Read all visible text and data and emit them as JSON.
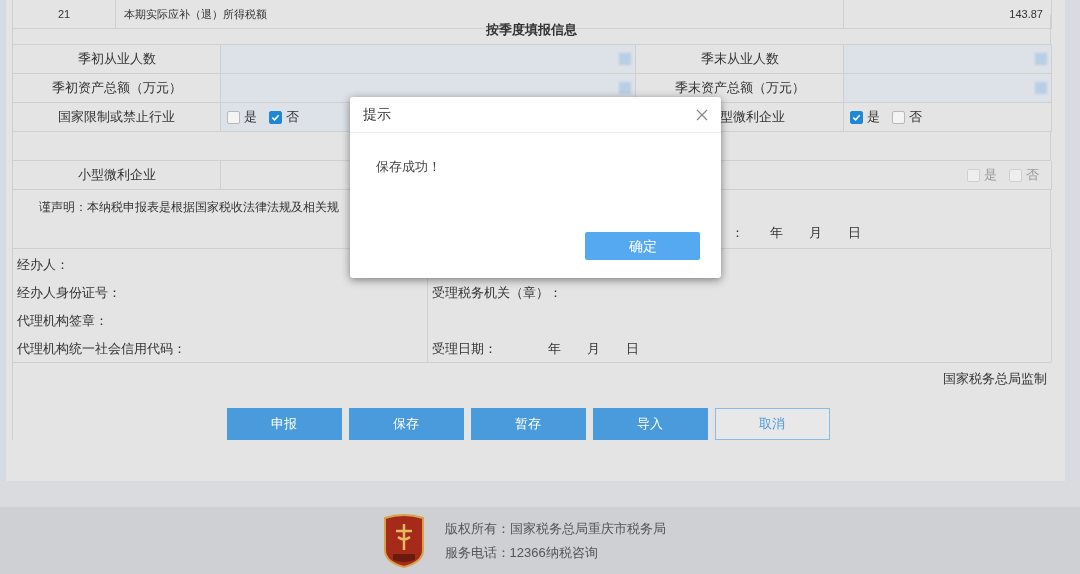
{
  "top_row": {
    "number": "21",
    "label": "本期实际应补（退）所得税额",
    "value": "143.87"
  },
  "section_title": "按季度填报信息",
  "rows": [
    {
      "kind": "pair",
      "left_label": "季初从业人数",
      "right_label": "季末从业人数"
    },
    {
      "kind": "pair",
      "left_label": "季初资产总额（万元）",
      "right_label": "季末资产总额（万元）"
    },
    {
      "kind": "checks",
      "left_label": "国家限制或禁止行业",
      "left_options": [
        {
          "label": "是",
          "checked": false
        },
        {
          "label": "否",
          "checked": true
        }
      ],
      "right_label": "型微利企业",
      "right_options": [
        {
          "label": "是",
          "checked": true
        },
        {
          "label": "否",
          "checked": false
        }
      ]
    },
    {
      "kind": "empty"
    },
    {
      "kind": "wide",
      "left_label": "小型微利企业",
      "options": [
        {
          "label": "是",
          "checked": false,
          "disabled": true
        },
        {
          "label": "否",
          "checked": false,
          "disabled": true
        }
      ]
    }
  ],
  "declaration": {
    "text": "谨声明：本纳税申报表是根据国家税收法律法规及相关规",
    "date": [
      "：",
      "年",
      "月",
      "日"
    ]
  },
  "signature_left": [
    "经办人：",
    "经办人身份证号：",
    "代理机构签章：",
    "代理机构统一社会信用代码："
  ],
  "signature_right": {
    "agency": "受理税务机关（章）：",
    "date_label": "受理日期：",
    "date": [
      "年",
      "月",
      "日"
    ]
  },
  "supervision": "国家税务总局监制",
  "buttons": [
    {
      "label": "申报",
      "kind": "primary"
    },
    {
      "label": "保存",
      "kind": "primary"
    },
    {
      "label": "暂存",
      "kind": "primary"
    },
    {
      "label": "导入",
      "kind": "primary"
    },
    {
      "label": "取消",
      "kind": "outline"
    }
  ],
  "footer": {
    "lines": [
      "版权所有：国家税务总局重庆市税务局",
      "服务电话：12366纳税咨询"
    ]
  },
  "dialog": {
    "title": "提示",
    "message": "保存成功！",
    "button": "确定"
  }
}
